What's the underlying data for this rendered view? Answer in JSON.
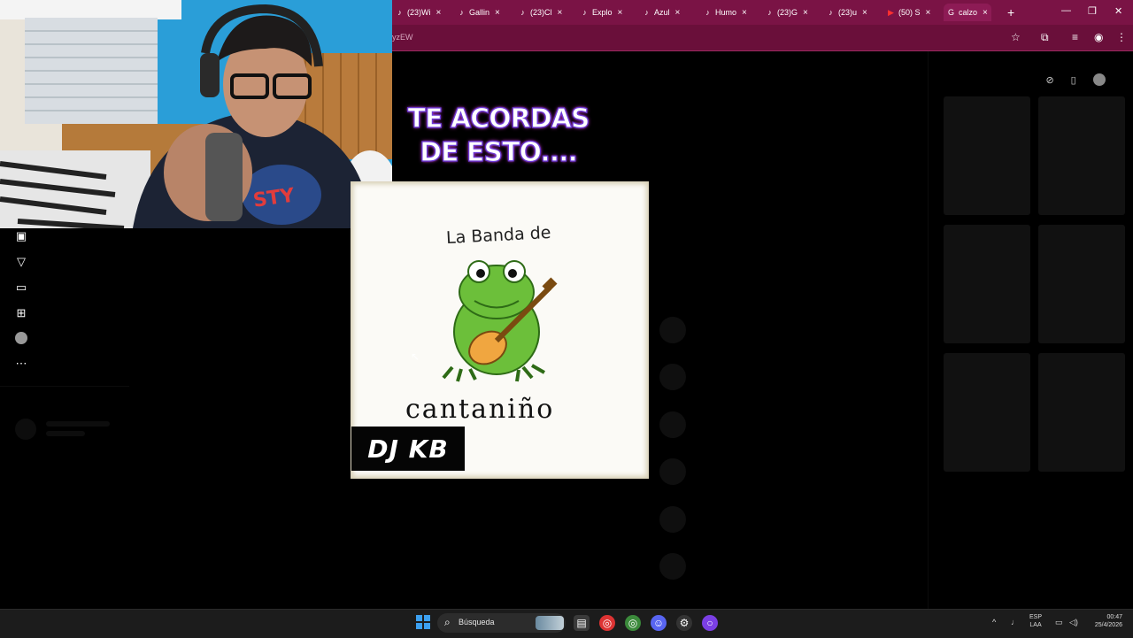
{
  "browser": {
    "tabs": [
      {
        "label": "(23)Wi",
        "icon": "tiktok-icon"
      },
      {
        "label": "Gallin",
        "icon": "tiktok-icon"
      },
      {
        "label": "(23)Cl",
        "icon": "tiktok-icon"
      },
      {
        "label": "Explo",
        "icon": "tiktok-icon"
      },
      {
        "label": "Azul",
        "icon": "tiktok-icon"
      },
      {
        "label": "Humo",
        "icon": "tiktok-icon"
      },
      {
        "label": "(23)G",
        "icon": "tiktok-icon"
      },
      {
        "label": "(23)u",
        "icon": "tiktok-icon"
      },
      {
        "label": "(50) S",
        "icon": "youtube-icon"
      },
      {
        "label": "calzo",
        "icon": "google-icon"
      }
    ],
    "new_tab": "+",
    "address_fragment": "yzEW",
    "tab_close": "×",
    "window_controls": {
      "minimize": "—",
      "maximize": "❐",
      "close": "✕"
    }
  },
  "overlay": {
    "line1": "TE ACORDAS",
    "line2": "DE ESTO...."
  },
  "cover": {
    "subtitle": "La Banda de",
    "band_name": "cantaniño",
    "dj_label": "DJ KB"
  },
  "taskbar": {
    "search_placeholder": "Búsqueda",
    "language_line1": "ESP",
    "language_line2": "LAA",
    "time": "00:47",
    "date": "25/4/2026"
  },
  "colors": {
    "tabbar": "#7a1345",
    "address_bar": "#6a0f3a",
    "overlay_stroke": "#6b3bd8"
  }
}
